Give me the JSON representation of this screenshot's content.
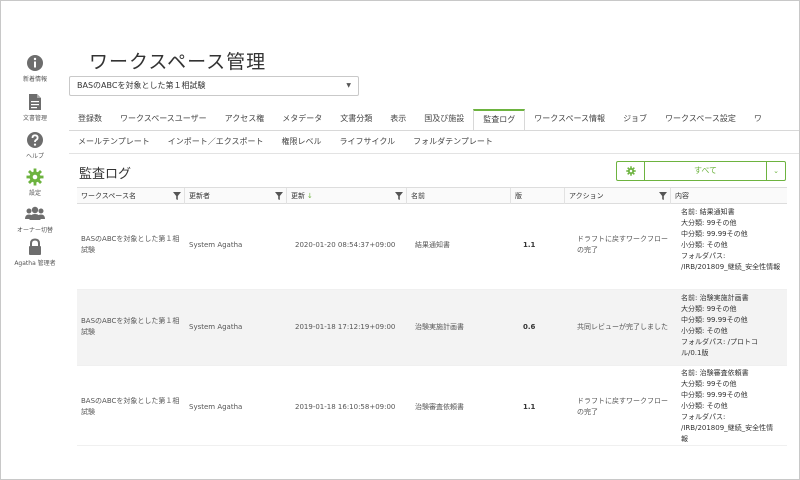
{
  "sidebar": {
    "items": [
      {
        "label": "新着情報",
        "icon": "info-icon"
      },
      {
        "label": "文書管理",
        "icon": "document-icon"
      },
      {
        "label": "ヘルプ",
        "icon": "help-icon"
      },
      {
        "label": "設定",
        "icon": "gear-icon"
      },
      {
        "label": "オーナー切替",
        "icon": "users-icon"
      },
      {
        "label": "Agatha 管理者",
        "icon": "lock-icon"
      }
    ]
  },
  "page": {
    "title": "ワークスペース管理",
    "workspace_select": "BASのABCを対象とした第１相試験"
  },
  "tabs_row1": [
    "登録数",
    "ワークスペースユーザー",
    "アクセス権",
    "メタデータ",
    "文書分類",
    "表示",
    "国及び施設",
    "監査ログ",
    "ワークスペース情報",
    "ジョブ",
    "ワークスペース設定",
    "ワ"
  ],
  "tabs_row2": [
    "メールテンプレート",
    "インポート／エクスポート",
    "権限レベル",
    "ライフサイクル",
    "フォルダテンプレート"
  ],
  "active_tab": "監査ログ",
  "section": {
    "title": "監査ログ",
    "filter_label": "すべて"
  },
  "table": {
    "headers": {
      "workspace": "ワークスペース名",
      "updater": "更新者",
      "updated": "更新",
      "name": "名前",
      "version": "版",
      "action": "アクション",
      "content": "内容"
    },
    "rows": [
      {
        "workspace": "BASのABCを対象とした第１相試験",
        "updater": "System Agatha",
        "updated": "2020-01-20 08:54:37+09:00",
        "name": "結果通知書",
        "version": "1.1",
        "action": "ドラフトに戻すワークフローの完了",
        "content": [
          "名前:  結果通知書",
          "大分類:  99その他",
          "中分類:  99.99その他",
          "小分類:  その他",
          "フォルダパス:",
          "/IRB/201809_継続_安全性情報"
        ]
      },
      {
        "workspace": "BASのABCを対象とした第１相試験",
        "updater": "System Agatha",
        "updated": "2019-01-18 17:12:19+09:00",
        "name": "治験実施計画書",
        "version": "0.6",
        "action": "共同レビューが完了しました",
        "content": [
          "名前:  治験実施計画書",
          "大分類:  99その他",
          "中分類:  99.99その他",
          "小分類:  その他",
          "フォルダパス:  /プロトコ",
          "ル/0.1版"
        ]
      },
      {
        "workspace": "BASのABCを対象とした第１相試験",
        "updater": "System Agatha",
        "updated": "2019-01-18 16:10:58+09:00",
        "name": "治験審査依頼書",
        "version": "1.1",
        "action": "ドラフトに戻すワークフローの完了",
        "content": [
          "名前:  治験審査依頼書",
          "大分類:  99その他",
          "中分類:  99.99その他",
          "小分類:  その他",
          "フォルダパス:",
          "/IRB/201809_継続_安全性情",
          "報"
        ]
      }
    ]
  },
  "colors": {
    "accent": "#6db33f",
    "icon_gray": "#6d6d6d"
  }
}
